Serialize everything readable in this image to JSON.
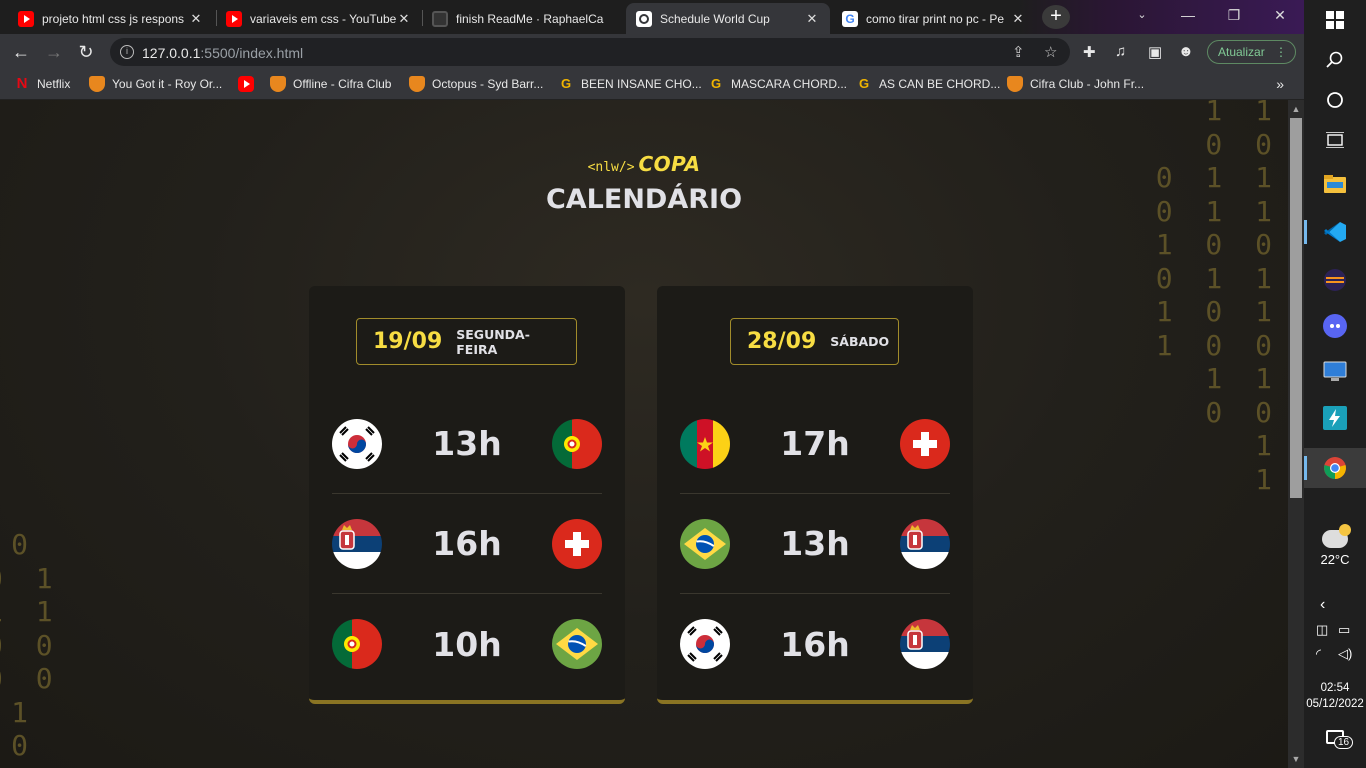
{
  "browser": {
    "tabs": [
      {
        "title": "projeto html css js respons",
        "favicon": "youtube-icon"
      },
      {
        "title": "variaveis em css - YouTube",
        "favicon": "youtube-icon"
      },
      {
        "title": "finish ReadMe · RaphaelCa",
        "favicon": "github-icon"
      },
      {
        "title": "Schedule World Cup",
        "favicon": "globe-icon",
        "active": true
      },
      {
        "title": "como tirar print no pc - Pe",
        "favicon": "google-icon"
      }
    ],
    "new_tab": "+",
    "url_host": "127.0.0.1",
    "url_rest": ":5500/index.html",
    "update_label": "Atualizar",
    "bookmarks": [
      {
        "label": "Netflix",
        "icon": "netflix-icon"
      },
      {
        "label": "You Got it - Roy Or...",
        "icon": "cifra-icon"
      },
      {
        "label": "",
        "icon": "youtube-icon"
      },
      {
        "label": "Offline - Cifra Club",
        "icon": "cifra-icon"
      },
      {
        "label": "Octopus - Syd Barr...",
        "icon": "cifra-icon"
      },
      {
        "label": "BEEN INSANE CHO...",
        "icon": "g-icon"
      },
      {
        "label": "MASCARA CHORD...",
        "icon": "g-icon"
      },
      {
        "label": "AS CAN BE CHORD...",
        "icon": "g-icon"
      },
      {
        "label": "Cifra Club - John Fr...",
        "icon": "cifra-icon"
      }
    ]
  },
  "page": {
    "logo_tag": "<nlw/>",
    "logo_copa": "COPA",
    "title": "CALENDÁRIO",
    "binary_right": "1 1\n0 0\n0 1 1\n0 1 1\n1 0 0\n0 1 1\n1 0 1\n1 0 0\n1 1\n0 0\n1\n1",
    "binary_left": "0\n0 1\n1 1\n0 0\n0 0\n1\n0",
    "cards": [
      {
        "date": "19/09",
        "weekday": "SEGUNDA-FEIRA",
        "matches": [
          {
            "home": "korea",
            "time": "13h",
            "away": "portugal"
          },
          {
            "home": "serbia",
            "time": "16h",
            "away": "switzerland"
          },
          {
            "home": "portugal",
            "time": "10h",
            "away": "brazil"
          }
        ]
      },
      {
        "date": "28/09",
        "weekday": "SÁBADO",
        "matches": [
          {
            "home": "cameroon",
            "time": "17h",
            "away": "switzerland"
          },
          {
            "home": "brazil",
            "time": "13h",
            "away": "serbia"
          },
          {
            "home": "korea",
            "time": "16h",
            "away": "serbia"
          }
        ]
      }
    ]
  },
  "taskbar": {
    "weather_temp": "22°C",
    "time": "02:54",
    "date": "05/12/2022",
    "notifications": "16"
  }
}
